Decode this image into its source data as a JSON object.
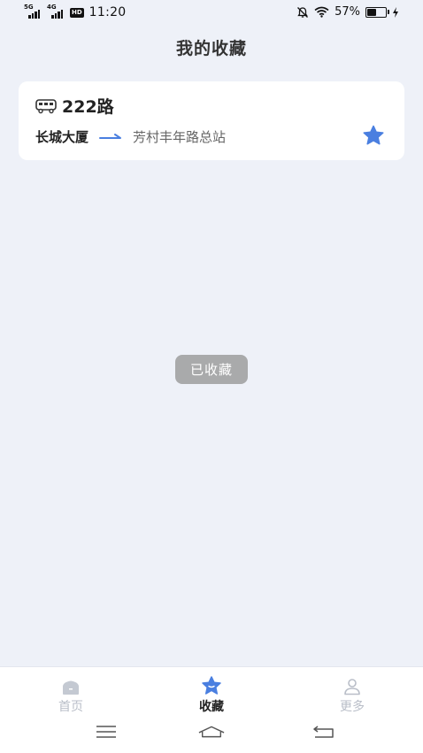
{
  "status_bar": {
    "signal1_label": "5G",
    "signal2_label": "4G",
    "hd_label": "HD",
    "time": "11:20",
    "battery_percent": "57%",
    "battery_level": 0.57,
    "icons": [
      "mute-bell-icon",
      "wifi-icon",
      "battery-icon",
      "charging-icon"
    ]
  },
  "header": {
    "title": "我的收藏"
  },
  "favorites": [
    {
      "route_icon": "bus-icon",
      "route_name": "222路",
      "from_stop": "长城大厦",
      "to_stop": "芳村丰年路总站",
      "favorited": true,
      "star_color": "#4a7fe0"
    }
  ],
  "toast": {
    "text": "已收藏"
  },
  "tab_bar": {
    "tabs": [
      {
        "label": "首页",
        "icon": "home-icon",
        "active": false
      },
      {
        "label": "收藏",
        "icon": "star-tab-icon",
        "active": true
      },
      {
        "label": "更多",
        "icon": "person-icon",
        "active": false
      }
    ]
  },
  "colors": {
    "background": "#eef1f8",
    "accent": "#4a7fe0",
    "inactive": "#b9bec8",
    "toast_bg": "#a9aaab"
  },
  "system_nav": {
    "icons": [
      "menu-icon",
      "home-nav-icon",
      "back-icon"
    ]
  }
}
